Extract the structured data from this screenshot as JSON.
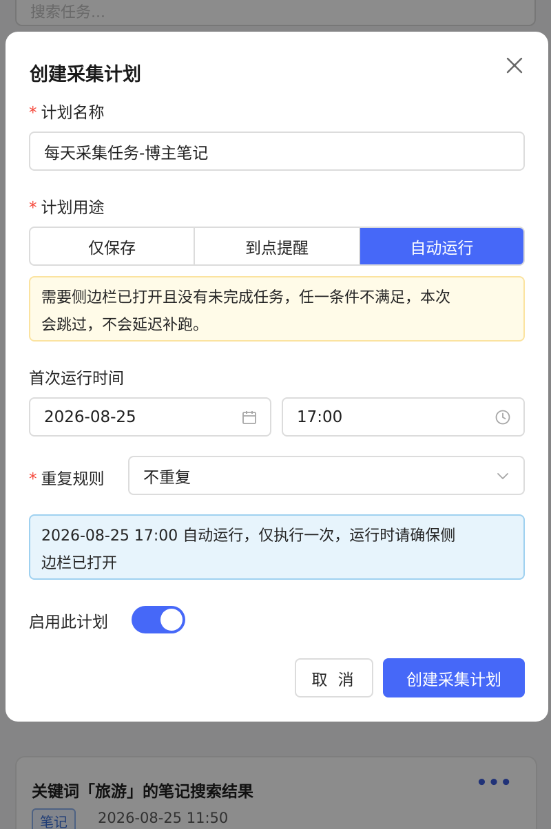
{
  "background": {
    "search_placeholder": "搜索任务...",
    "card": {
      "title": "关键词「旅游」的笔记搜索结果",
      "more_glyph": "•••",
      "tag": "笔记",
      "time": "2026-08-25 11:50"
    }
  },
  "modal": {
    "title": "创建采集计划",
    "close_glyph": "×",
    "name_field": {
      "required_mark": "*",
      "label": "计划名称",
      "value": "每天采集任务-博主笔记"
    },
    "purpose_field": {
      "required_mark": "*",
      "label": "计划用途",
      "options": [
        {
          "label": "仅保存",
          "active": false
        },
        {
          "label": "到点提醒",
          "active": false
        },
        {
          "label": "自动运行",
          "active": true
        }
      ]
    },
    "warning_line1": "需要侧边栏已打开且没有未完成任务，任一条件不满足，本次",
    "warning_line2": "会跳过，不会延迟补跑。",
    "first_run": {
      "label": "首次运行时间",
      "date": "2026-08-25",
      "time": "17:00"
    },
    "repeat_field": {
      "required_mark": "*",
      "label": "重复规则",
      "value": "不重复"
    },
    "info_line1": "2026-08-25 17:00 自动运行，仅执行一次，运行时请确保侧",
    "info_line2": "边栏已打开",
    "enable": {
      "label": "启用此计划",
      "on": true
    },
    "buttons": {
      "cancel": "取 消",
      "submit": "创建采集计划"
    }
  },
  "colors": {
    "primary": "#4668f8",
    "required": "#f5483b",
    "warning_bg": "#fffbe8",
    "info_bg": "#e7f4fc"
  }
}
